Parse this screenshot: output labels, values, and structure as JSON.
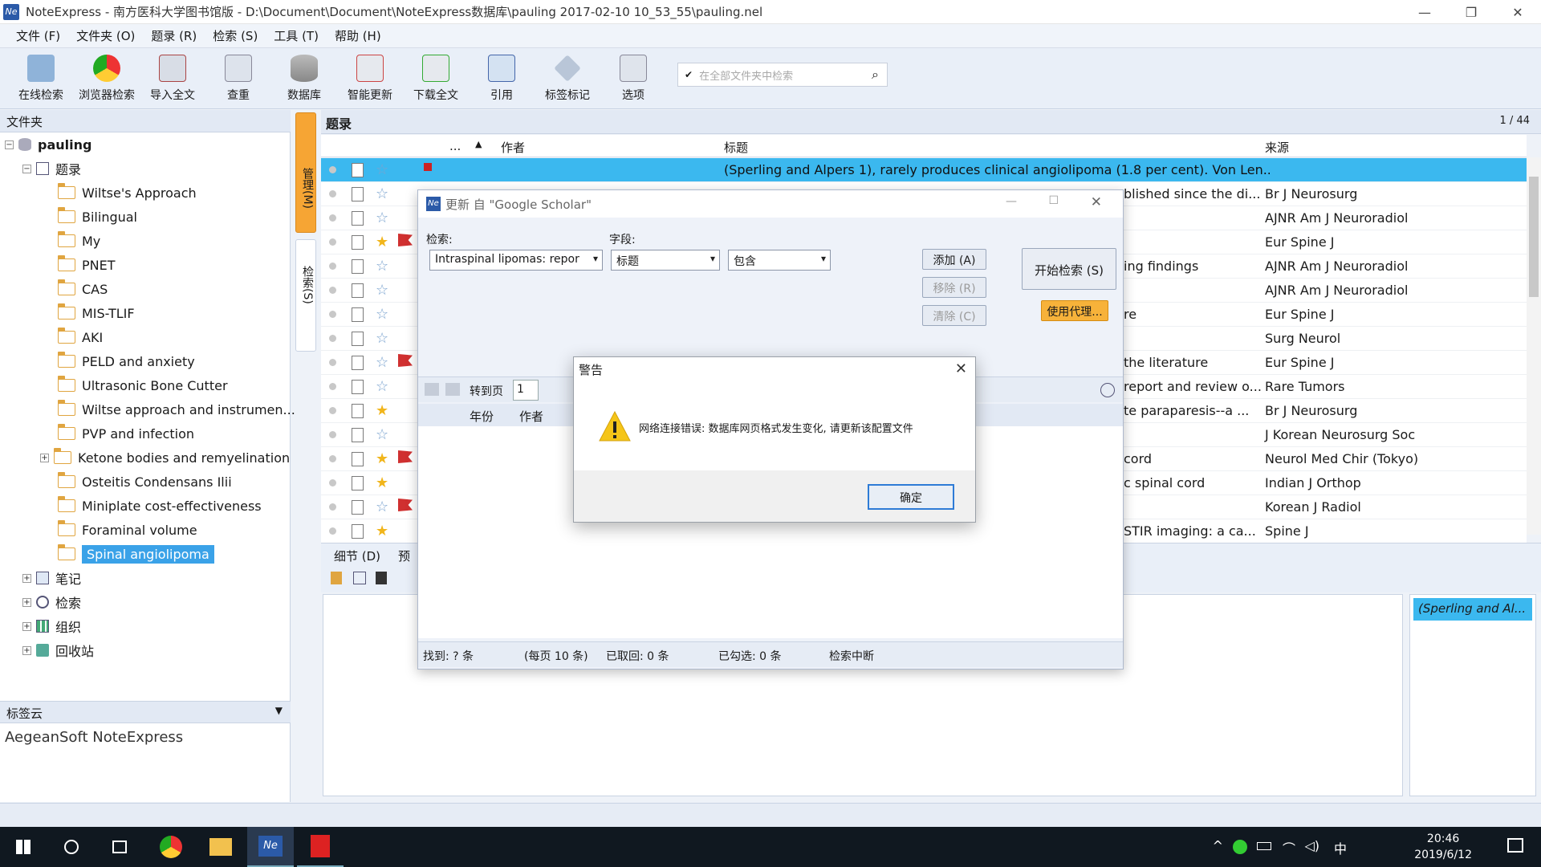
{
  "window": {
    "title": "NoteExpress - 南方医科大学图书馆版 - D:\\Document\\Document\\NoteExpress数据库\\pauling 2017-02-10 10_53_55\\pauling.nel",
    "app_icon": "Ne"
  },
  "menu": [
    "文件 (F)",
    "文件夹 (O)",
    "题录 (R)",
    "检索 (S)",
    "工具 (T)",
    "帮助 (H)"
  ],
  "toolbar": {
    "buttons": [
      "在线检索",
      "浏览器检索",
      "导入全文",
      "查重",
      "数据库",
      "智能更新",
      "下载全文",
      "引用",
      "标签标记",
      "选项"
    ],
    "search_placeholder": "在全部文件夹中检索"
  },
  "left": {
    "header": "文件夹",
    "db_name": "pauling",
    "records_node": "题录",
    "folders": [
      "Wiltse's Approach",
      "Bilingual",
      "My",
      "PNET",
      "CAS",
      "MIS-TLIF",
      "AKI",
      "PELD and anxiety",
      "Ultrasonic Bone Cutter",
      "Wiltse approach and instrumen...",
      "PVP and infection",
      "Ketone bodies and remyelination",
      "Osteitis Condensans Ilii",
      "Miniplate cost-effectiveness",
      "Foraminal volume",
      "Spinal angiolipoma"
    ],
    "other_nodes": [
      "笔记",
      "检索",
      "组织",
      "回收站"
    ],
    "tagcloud_header": "标签云",
    "tags": "AegeanSoft   NoteExpress"
  },
  "sidetabs": {
    "manage": "管理(M)",
    "search": "检索(S)"
  },
  "main": {
    "header": "题录",
    "page": "1 / 44",
    "columns": {
      "dots": "...",
      "author": "作者",
      "title": "标题",
      "source": "来源"
    },
    "selected_title": "(Sperling and Alpers 1), rarely produces clinical angiolipoma (1.8 per cent). Von Len...",
    "rows": [
      {
        "title": "blished since the di...",
        "source": "Br J Neurosurg",
        "star": false,
        "flag": false
      },
      {
        "title": "",
        "source": "AJNR Am J Neuroradiol",
        "star": false,
        "flag": false
      },
      {
        "title": "",
        "source": "Eur Spine J",
        "star": true,
        "flag": true
      },
      {
        "title": "ing findings",
        "source": "AJNR Am J Neuroradiol",
        "star": false,
        "flag": false
      },
      {
        "title": "",
        "source": "AJNR Am J Neuroradiol",
        "star": false,
        "flag": false
      },
      {
        "title": "re",
        "source": "Eur Spine J",
        "star": false,
        "flag": false
      },
      {
        "title": "",
        "source": "Surg Neurol",
        "star": false,
        "flag": false
      },
      {
        "title": "the literature",
        "source": "Eur Spine J",
        "star": false,
        "flag": true
      },
      {
        "title": "report and review o...",
        "source": "Rare Tumors",
        "star": false,
        "flag": false
      },
      {
        "title": "te paraparesis--a ...",
        "source": "Br J Neurosurg",
        "star": true,
        "flag": false
      },
      {
        "title": "",
        "source": "J Korean Neurosurg Soc",
        "star": false,
        "flag": false
      },
      {
        "title": "cord",
        "source": "Neurol Med Chir (Tokyo)",
        "star": true,
        "flag": true
      },
      {
        "title": "c spinal cord",
        "source": "Indian J Orthop",
        "star": true,
        "flag": false
      },
      {
        "title": "",
        "source": "Korean J Radiol",
        "star": false,
        "flag": true
      },
      {
        "title": "STIR imaging: a ca...",
        "source": "Spine J",
        "star": true,
        "flag": false
      }
    ],
    "detail_tabs": [
      "细节 (D)",
      "预"
    ],
    "right_item": "(Sperling and Al..."
  },
  "update_dialog": {
    "title": "更新 自 \"Google Scholar\"",
    "search_label": "检索:",
    "search_value": "Intraspinal lipomas: repor",
    "field_label": "字段:",
    "field_value": "标题",
    "op_value": "包含",
    "add": "添加 (A)",
    "remove": "移除 (R)",
    "clear": "清除 (C)",
    "start": "开始检索 (S)",
    "proxy": "使用代理...",
    "goto_label": "转到页",
    "goto_value": "1",
    "col_year": "年份",
    "col_author": "作者",
    "status": {
      "found": "找到: ? 条",
      "per_page": "(每页 10 条)",
      "fetched": "已取回: 0 条",
      "checked": "已勾选: 0 条",
      "state": "检索中断"
    }
  },
  "alert": {
    "title": "警告",
    "message": "网络连接错误: 数据库网页格式发生变化, 请更新该配置文件",
    "ok": "确定"
  },
  "taskbar": {
    "time": "20:46",
    "date": "2019/6/12",
    "ime": "中"
  },
  "colors": {
    "accent": "#3bb8ef",
    "selection": "#3aa2e8",
    "orange": "#f7b23a"
  }
}
